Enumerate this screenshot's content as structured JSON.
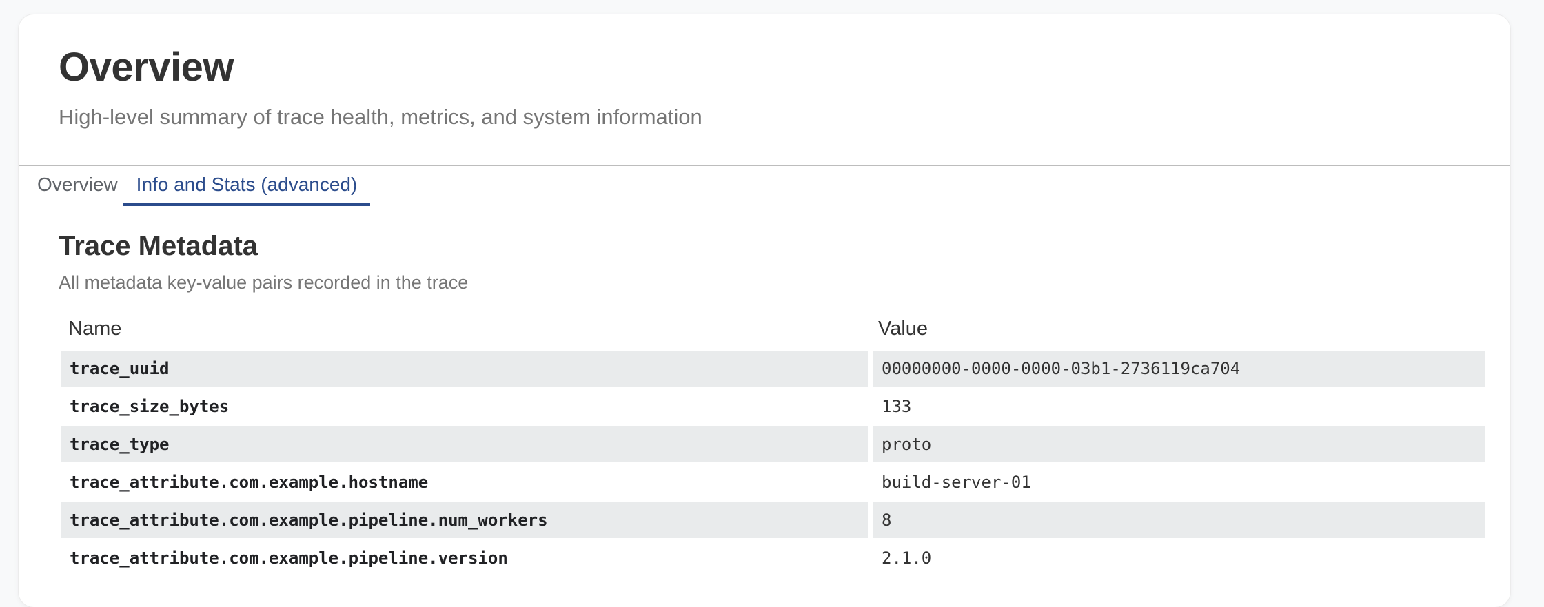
{
  "header": {
    "title": "Overview",
    "subtitle": "High-level summary of trace health, metrics, and system information"
  },
  "tabs": [
    {
      "label": "Overview",
      "active": false
    },
    {
      "label": "Info and Stats (advanced)",
      "active": true
    }
  ],
  "section": {
    "title": "Trace Metadata",
    "subtitle": "All metadata key-value pairs recorded in the trace"
  },
  "table": {
    "columns": [
      "Name",
      "Value"
    ],
    "rows": [
      {
        "name": "trace_uuid",
        "value": "00000000-0000-0000-03b1-2736119ca704"
      },
      {
        "name": "trace_size_bytes",
        "value": "133"
      },
      {
        "name": "trace_type",
        "value": "proto"
      },
      {
        "name": "trace_attribute.com.example.hostname",
        "value": "build-server-01"
      },
      {
        "name": "trace_attribute.com.example.pipeline.num_workers",
        "value": "8"
      },
      {
        "name": "trace_attribute.com.example.pipeline.version",
        "value": "2.1.0"
      }
    ]
  },
  "colors": {
    "accent": "#2b4c8c",
    "row_shade": "#e9ebec",
    "muted_text": "#757575"
  }
}
